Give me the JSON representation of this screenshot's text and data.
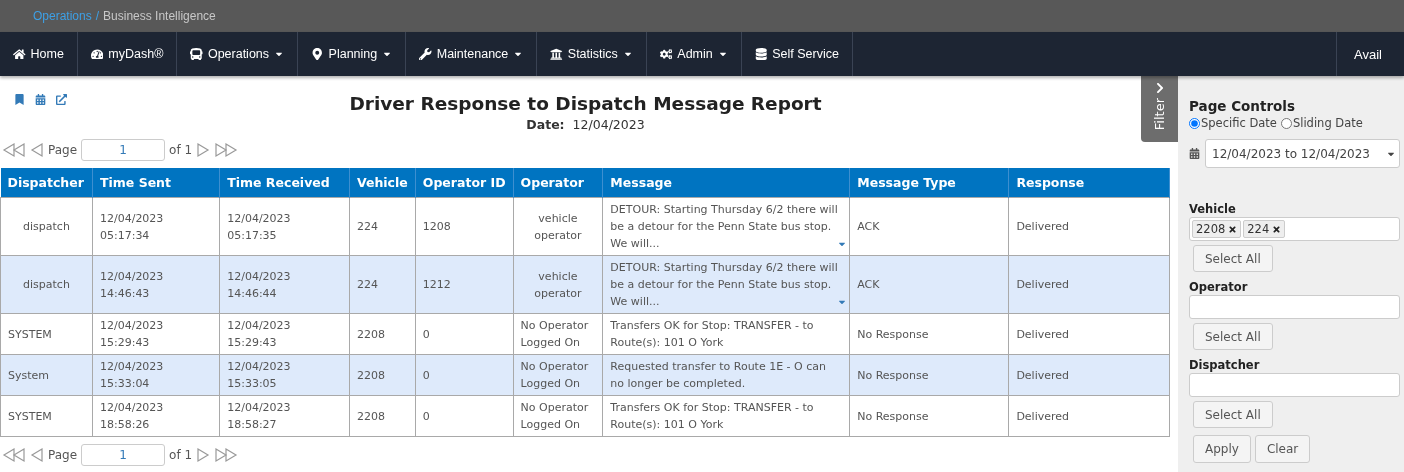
{
  "breadcrumb": {
    "parent": "Operations",
    "separator": "/",
    "current": "Business Intelligence"
  },
  "nav": {
    "items": [
      {
        "label": "Home",
        "dropdown": false
      },
      {
        "label": "myDash®",
        "dropdown": false
      },
      {
        "label": "Operations",
        "dropdown": true
      },
      {
        "label": "Planning",
        "dropdown": true
      },
      {
        "label": "Maintenance",
        "dropdown": true
      },
      {
        "label": "Statistics",
        "dropdown": true
      },
      {
        "label": "Admin",
        "dropdown": true
      },
      {
        "label": "Self Service",
        "dropdown": false
      }
    ],
    "user": "Avail"
  },
  "report": {
    "title": "Driver Response to Dispatch Message Report",
    "date_label": "Date:",
    "date": "12/04/2023"
  },
  "pager_top": {
    "label": "Page",
    "value": "1",
    "of": "of 1"
  },
  "table": {
    "columns": [
      "Dispatcher",
      "Time Sent",
      "Time Received",
      "Vehicle",
      "Operator ID",
      "Operator",
      "Message",
      "Message Type",
      "Response"
    ],
    "rows": [
      {
        "cells": [
          "dispatch",
          "12/04/2023 05:17:34",
          "12/04/2023 05:17:35",
          "224",
          "1208",
          "vehicle operator",
          "DETOUR: Starting Thursday 6/2 there will be a detour for the Penn State bus stop. We will...",
          "ACK",
          "Delivered"
        ],
        "expandable": true
      },
      {
        "cells": [
          "dispatch",
          "12/04/2023 14:46:43",
          "12/04/2023 14:46:44",
          "224",
          "1212",
          "vehicle operator",
          "DETOUR: Starting Thursday 6/2 there will be a detour for the Penn State bus stop. We will...",
          "ACK",
          "Delivered"
        ],
        "expandable": true
      },
      {
        "cells": [
          "SYSTEM",
          "12/04/2023 15:29:43",
          "12/04/2023 15:29:43",
          "2208",
          "0",
          "No Operator Logged On",
          "Transfers OK for Stop: TRANSFER - to Route(s): 101 O York",
          "No Response",
          "Delivered"
        ],
        "expandable": false
      },
      {
        "cells": [
          "System",
          "12/04/2023 15:33:04",
          "12/04/2023 15:33:05",
          "2208",
          "0",
          "No Operator Logged On",
          "Requested transfer to Route 1E - O can no longer be completed.",
          "No Response",
          "Delivered"
        ],
        "expandable": false
      },
      {
        "cells": [
          "SYSTEM",
          "12/04/2023 18:58:26",
          "12/04/2023 18:58:27",
          "2208",
          "0",
          "No Operator Logged On",
          "Transfers OK for Stop: TRANSFER - to Route(s): 101 O York",
          "No Response",
          "Delivered"
        ],
        "expandable": false
      }
    ]
  },
  "pager_bottom": {
    "label": "Page",
    "value": "1",
    "of": "of 1"
  },
  "filter_tab": {
    "label": "Filter"
  },
  "page_controls": {
    "title": "Page Controls",
    "date_modes": [
      {
        "label": "Specific Date",
        "selected": true
      },
      {
        "label": "Sliding Date",
        "selected": false
      }
    ],
    "date_range": "12/04/2023 to 12/04/2023",
    "filters": [
      {
        "label": "Vehicle",
        "chips": [
          "2208",
          "224"
        ],
        "button": "Select All"
      },
      {
        "label": "Operator",
        "button": "Select All"
      },
      {
        "label": "Dispatcher",
        "button": "Select All"
      }
    ],
    "actions": [
      "Apply",
      "Clear"
    ]
  }
}
